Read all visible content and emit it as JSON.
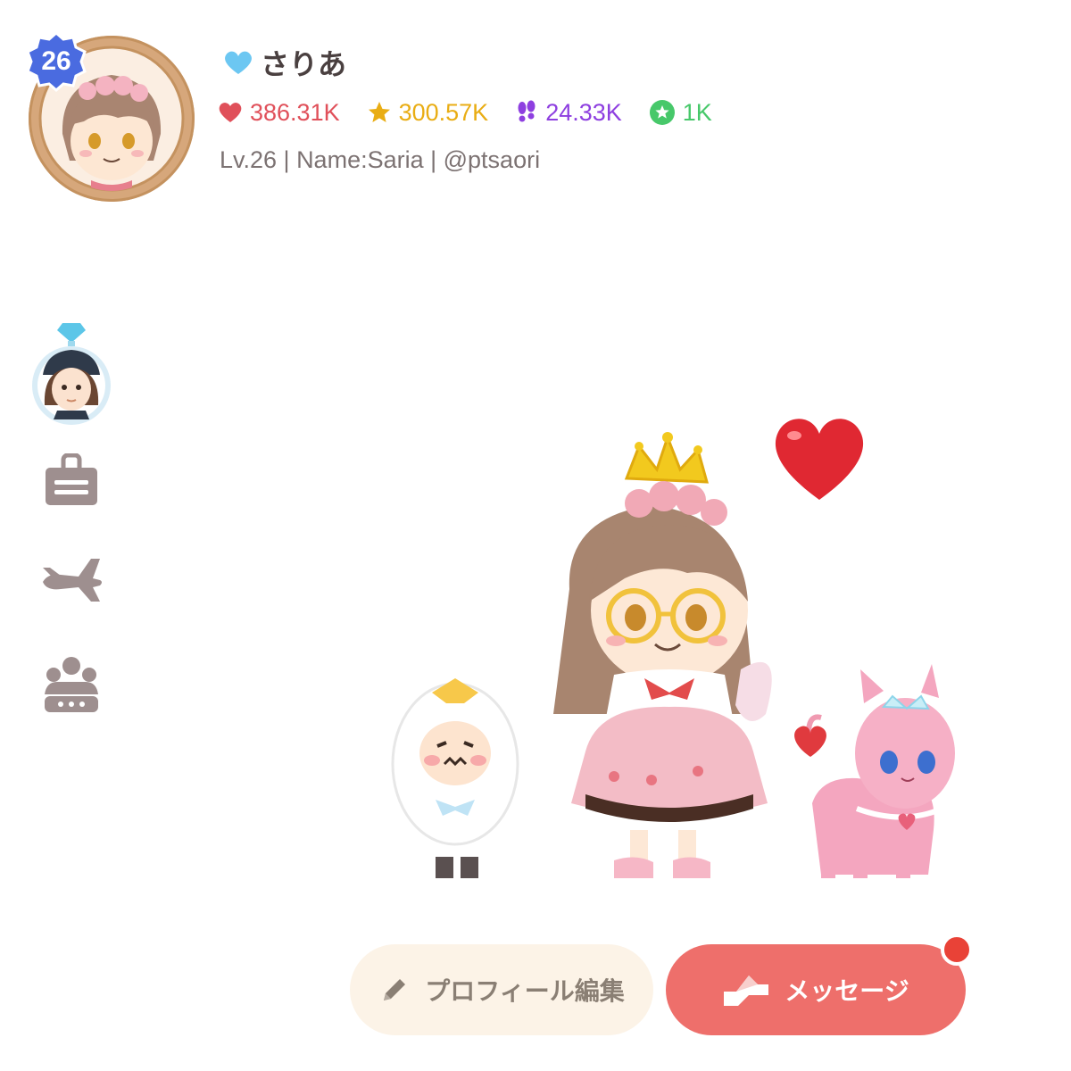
{
  "profile": {
    "level_badge": "26",
    "display_name": "さりあ",
    "meta": "Lv.26 | Name:Saria | @ptsaori"
  },
  "stats": {
    "likes": "386.31K",
    "stars": "300.57K",
    "steps": "24.33K",
    "points": "1K"
  },
  "side_menu": {
    "items": [
      "character-avatar",
      "id-card-icon",
      "airplane-icon",
      "group-icon"
    ]
  },
  "buttons": {
    "edit_profile": "プロフィール編集",
    "message": "メッセージ"
  },
  "colors": {
    "like": "#e0505a",
    "star": "#e9ad14",
    "step": "#8e3fe0",
    "point": "#47c86a",
    "accent": "#ee6f6b",
    "badge": "#4a6be0"
  }
}
